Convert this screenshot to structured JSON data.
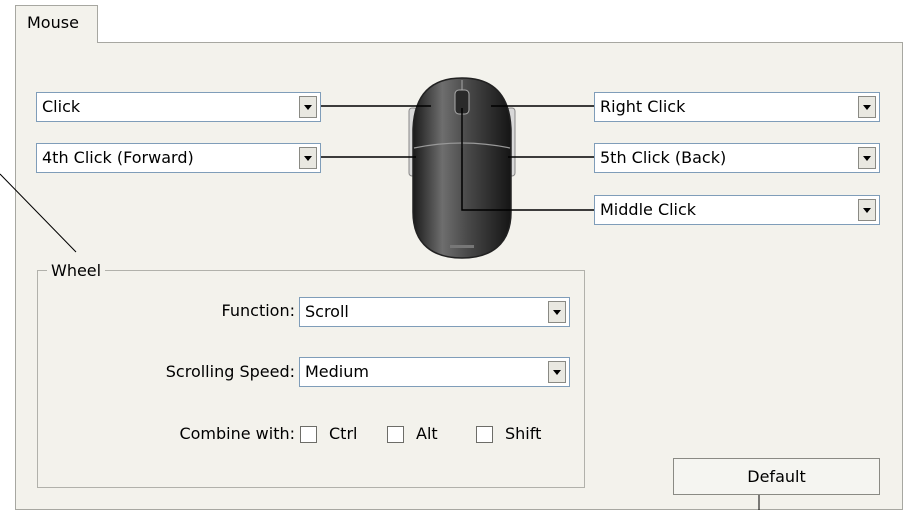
{
  "tabs": [
    {
      "label": "Mouse"
    }
  ],
  "buttons_mapping": {
    "left_button": "Click",
    "side_button_front": "4th Click (Forward)",
    "right_button": "Right Click",
    "side_button_back": "5th Click (Back)",
    "middle_button": "Middle Click"
  },
  "wheel": {
    "group_label": "Wheel",
    "function_label": "Function:",
    "function_value": "Scroll",
    "speed_label": "Scrolling Speed:",
    "speed_value": "Medium",
    "combine_label": "Combine with:",
    "modifiers": [
      {
        "label": "Ctrl",
        "checked": false
      },
      {
        "label": "Alt",
        "checked": false
      },
      {
        "label": "Shift",
        "checked": false
      }
    ]
  },
  "default_button": "Default",
  "colors": {
    "panel_bg": "#f3f2ec",
    "border": "#a7a7a1",
    "field_border": "#7f9db9"
  }
}
